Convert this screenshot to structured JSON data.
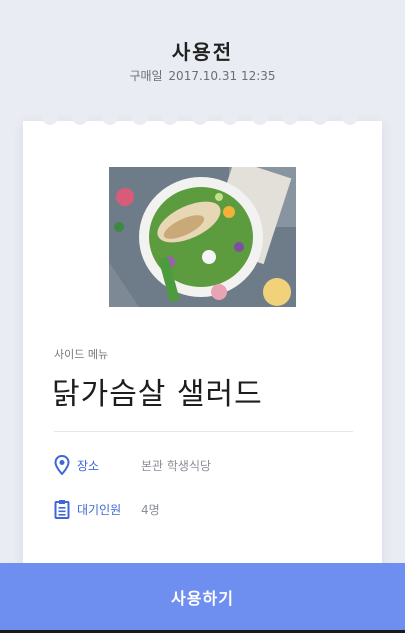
{
  "header": {
    "status_title": "사용전",
    "purchase_label": "구매일",
    "purchase_datetime": "2017.10.31 12:35"
  },
  "coupon": {
    "category": "사이드 메뉴",
    "menu_name": "닭가슴살 샐러드",
    "location_label": "장소",
    "location_value": "본관 학생식당",
    "waiting_label": "대기인원",
    "waiting_value": "4명",
    "icons": {
      "location": "location-pin-icon",
      "waiting": "clipboard-icon"
    },
    "accent_color": "#3f67d8"
  },
  "actions": {
    "use_label": "사용하기",
    "button_color": "#6f8ff0"
  }
}
